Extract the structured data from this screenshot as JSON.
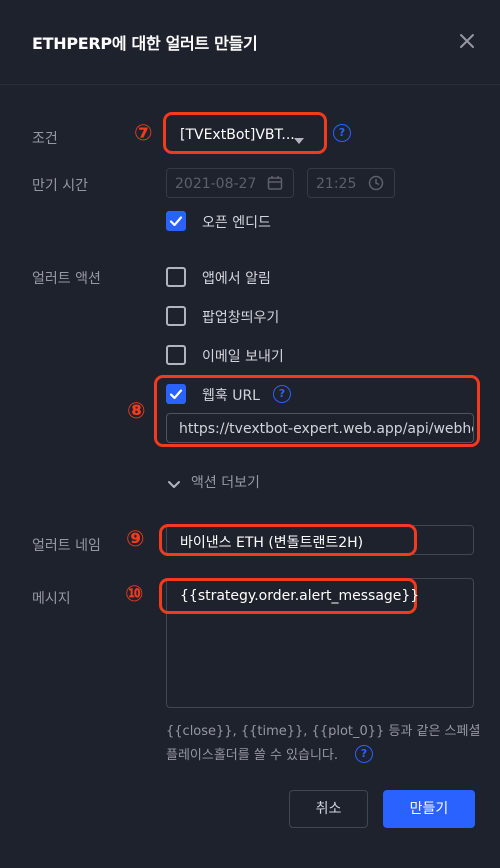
{
  "dialog": {
    "title": "ETHPERP에 대한 얼러트 만들기",
    "close_icon": "close-icon"
  },
  "condition": {
    "label": "조건",
    "marker": "⑦",
    "value": "[TVExtBot]VBT...",
    "help": "?"
  },
  "expiration": {
    "label": "만기 시간",
    "date": "2021-08-27",
    "time": "21:25",
    "open_ended_label": "오픈 엔디드",
    "open_ended_checked": true
  },
  "actions": {
    "label": "얼러트 액션",
    "items": [
      {
        "label": "앱에서 알림",
        "checked": false
      },
      {
        "label": "팝업창띄우기",
        "checked": false
      },
      {
        "label": "이메일 보내기",
        "checked": false
      }
    ],
    "webhook": {
      "marker": "⑧",
      "label": "웹훅 URL",
      "checked": true,
      "url": "https://tvextbot-expert.web.app/api/webhook",
      "help": "?"
    },
    "more_label": "액션 더보기"
  },
  "alert_name": {
    "label": "얼러트 네임",
    "marker": "⑨",
    "value": "바이낸스 ETH (변돌트랜트2H)"
  },
  "message": {
    "label": "메시지",
    "marker": "⑩",
    "value": "{{strategy.order.alert_message}}",
    "hint_line1": "{{close}}, {{time}}, {{plot_0}} 등과 같은 스페셜",
    "hint_line2": "플레이스홀더를 쓸 수 있습니다.",
    "help": "?"
  },
  "buttons": {
    "cancel": "취소",
    "create": "만들기"
  },
  "colors": {
    "background": "#1e222d",
    "accent": "#2962ff",
    "annotation": "#f23a1c"
  }
}
